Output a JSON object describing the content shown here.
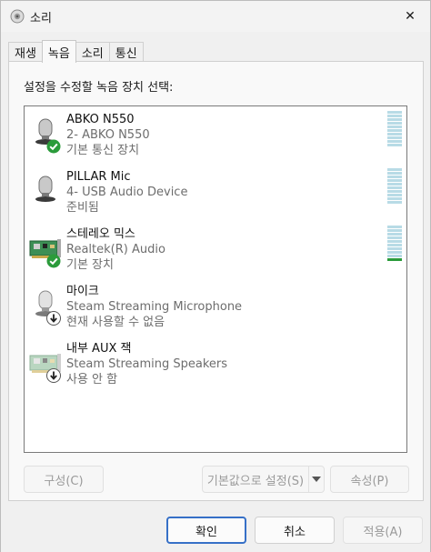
{
  "window": {
    "title": "소리",
    "close_glyph": "✕"
  },
  "tabs": [
    {
      "label": "재생",
      "active": false
    },
    {
      "label": "녹음",
      "active": true
    },
    {
      "label": "소리",
      "active": false
    },
    {
      "label": "통신",
      "active": false
    }
  ],
  "instruction": "설정을 수정할 녹음 장치 선택:",
  "devices": [
    {
      "name": "ABKO N550",
      "line2": "2- ABKO N550",
      "line3": "기본 통신 장치",
      "icon": "microphone-icon",
      "badge": "check-icon",
      "meter": true,
      "level": 0
    },
    {
      "name": "PILLAR Mic",
      "line2": "4- USB Audio Device",
      "line3": "준비됨",
      "icon": "microphone-icon",
      "badge": "",
      "meter": true,
      "level": 0
    },
    {
      "name": "스테레오 믹스",
      "line2": "Realtek(R) Audio",
      "line3": "기본 장치",
      "icon": "sound-card-icon",
      "badge": "check-icon",
      "meter": true,
      "level": 0.1
    },
    {
      "name": "마이크",
      "line2": "Steam Streaming Microphone",
      "line3": "현재 사용할 수 없음",
      "icon": "microphone-icon",
      "badge": "down-arrow-icon",
      "meter": false,
      "level": 0
    },
    {
      "name": "내부 AUX 잭",
      "line2": "Steam Streaming Speakers",
      "line3": "사용 안 함",
      "icon": "sound-card-icon",
      "badge": "down-arrow-icon",
      "meter": false,
      "level": 0
    }
  ],
  "buttons": {
    "configure": "구성(C)",
    "set_default": "기본값으로 설정(S)",
    "properties": "속성(P)",
    "ok": "확인",
    "cancel": "취소",
    "apply": "적용(A)"
  },
  "colors": {
    "accent": "#3670c7",
    "default_badge": "#2b9b3b",
    "meter_idle": "#b8dbe6"
  }
}
